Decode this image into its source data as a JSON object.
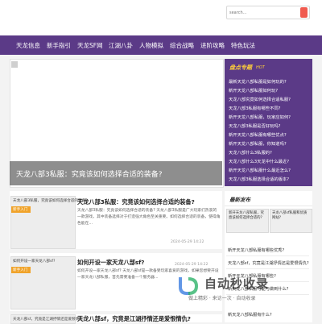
{
  "search": {
    "placeholder": "search..."
  },
  "nav": {
    "items": [
      "天龙信息",
      "新手指引",
      "天龙SF网",
      "江湖八卦",
      "人物模拟",
      "综合战略",
      "进阶攻略",
      "特色玩法"
    ]
  },
  "hero": {
    "caption": "天龙八部3私服：究竟该如何选择合适的装备?"
  },
  "sidebar": {
    "title": "盘点专题",
    "title_tag": "HOT",
    "items": [
      "最新天龙八部私服是如何玩的?",
      "新开天龙八部私服如何玩?",
      "天龙八部究竟如何选择合适私服?",
      "天龙八部3私服有哪些不同?",
      "新开天龙八部私服，玩家应如何?",
      "天龙八部3私服是否好玩吗?",
      "新开天龙八部私服有哪些优点?",
      "新开天龙八部私服，你知道吗?",
      "天龙八部什么3私服的?",
      "天龙八部什么3天龙中什么最近?",
      "新开天龙八部私服什么最近怎么?",
      "天龙八部3私服选择合适的版本?"
    ]
  },
  "articles": [
    {
      "thumb_caption": "天龙八部3私服，究竟该如何选择合适的装备?",
      "title": "天龙八部3私服：究竟该如何选择合适的装备?",
      "body": "天龙八部3私服：究竟该如何选择合适的装备? 天龙八部3私服是广大玩家们热衷的一款游戏，其中装备选择对于打造强大角色至关重要。如何选择合适的装备，使得角色能在...",
      "meta": "2024-05-29 14:22"
    },
    {
      "thumb_caption": "如何开设一家天龙八部sf?",
      "title": "如何开设一家天龙八部sf?",
      "body": "如何开设一家天龙八部sf? 天龙八部sf是一款备受玩家喜爱的游戏，如果您想要开设一家天龙八部私服，首先需要准备一个服务器...",
      "meta": "2024-05-29 14:22"
    },
    {
      "thumb_caption": "天龙八部sf，究竟是江湖抒情还是爱恨情仇?",
      "title": "天龙八部sf，究竟是江湖抒情还是爱恨情仇?",
      "body": "",
      "meta": ""
    }
  ],
  "badge": "新手入门",
  "right_col": {
    "title": "最新发布",
    "thumb_captions": [
      "新开天龙八部私服，究竟该如何选择合适的?",
      "天龙八部sf私服和优质网站?"
    ],
    "items": [
      "新开天龙八部私服有哪些优秀?",
      "天龙八部sf，究竟是江湖抒情还是爱恨情仇?",
      "新开天龙八部私服有哪些?",
      "新天龙八部私服可能与做到什么?",
      "新天龙八部私服有什么?"
    ]
  },
  "watermark": {
    "big": "自动秒收录",
    "small": "做上精彩 · 来访一次 · 自动收录"
  },
  "colors": {
    "nav_bg": "#5b3a87",
    "search_btn": "#f05a4f",
    "badge": "#f0a32a",
    "side_title": "#ffcf3a"
  }
}
